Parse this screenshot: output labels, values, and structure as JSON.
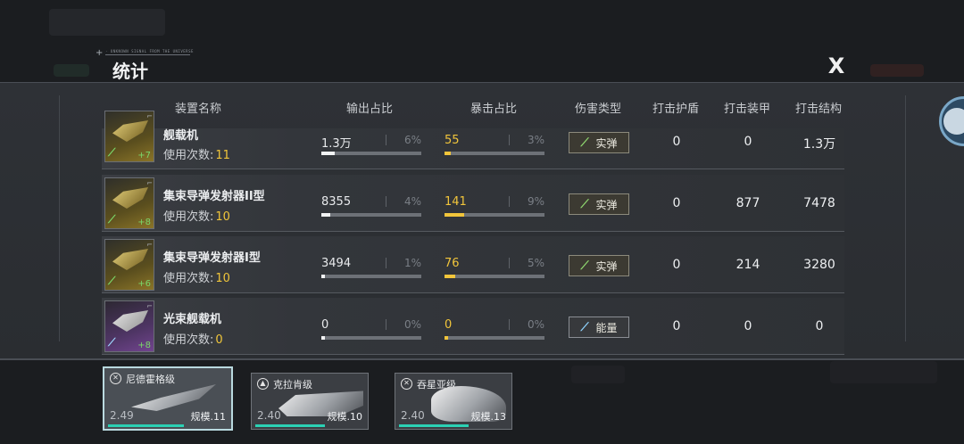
{
  "header": {
    "small_caption": "· UNKNOWN SIGNAL FROM THE UNIVERSE",
    "title": "统计",
    "close_label": "X"
  },
  "columns": {
    "equipment_name": "装置名称",
    "output_ratio": "输出占比",
    "crit_ratio": "暴击占比",
    "damage_type": "伤害类型",
    "hit_shield": "打击护盾",
    "hit_armor": "打击装甲",
    "hit_structure": "打击结构"
  },
  "uses_label": "使用次数:",
  "rows": [
    {
      "name": "舰载机",
      "uses": "11",
      "level": "+7",
      "quality": "gold",
      "output": "1.3万",
      "output_pct": "6%",
      "output_fraction": 0.06,
      "crit": "55",
      "crit_pct": "3%",
      "crit_fraction": 0.03,
      "damage_type": "实弹",
      "damage_icon": "kinetic-icon",
      "shield": "0",
      "armor": "0",
      "structure": "1.3万"
    },
    {
      "name": "集束导弹发射器II型",
      "uses": "10",
      "level": "+8",
      "quality": "gold",
      "output": "8355",
      "output_pct": "4%",
      "output_fraction": 0.04,
      "crit": "141",
      "crit_pct": "9%",
      "crit_fraction": 0.09,
      "damage_type": "实弹",
      "damage_icon": "kinetic-icon",
      "shield": "0",
      "armor": "877",
      "structure": "7478"
    },
    {
      "name": "集束导弹发射器I型",
      "uses": "10",
      "level": "+6",
      "quality": "gold",
      "output": "3494",
      "output_pct": "1%",
      "output_fraction": 0.01,
      "crit": "76",
      "crit_pct": "5%",
      "crit_fraction": 0.05,
      "damage_type": "实弹",
      "damage_icon": "kinetic-icon",
      "shield": "0",
      "armor": "214",
      "structure": "3280"
    },
    {
      "name": "光束舰载机",
      "uses": "0",
      "level": "+8",
      "quality": "purple",
      "output": "0",
      "output_pct": "0%",
      "output_fraction": 0,
      "crit": "0",
      "crit_pct": "0%",
      "crit_fraction": 0,
      "damage_type": "能量",
      "damage_icon": "energy-icon",
      "shield": "0",
      "armor": "0",
      "structure": "0"
    }
  ],
  "ships": [
    {
      "name": "尼德霍格级",
      "power": "2.49",
      "scale": "规模.11",
      "selected": true
    },
    {
      "name": "克拉肯级",
      "power": "2.40",
      "scale": "规模.10",
      "selected": false
    },
    {
      "name": "吞星亚级",
      "power": "2.40",
      "scale": "规模.13",
      "selected": false
    }
  ],
  "colors": {
    "crit_accent": "#f2c53b",
    "uses_accent": "#f0c53a",
    "kinetic_green": "#8fd86f",
    "selected_outline": "#b9d9df",
    "progress_teal": "#2bd1b4"
  }
}
